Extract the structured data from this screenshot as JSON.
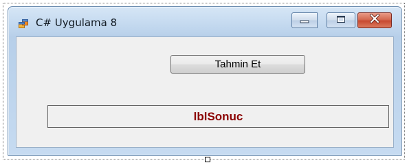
{
  "window": {
    "title": "C# Uygulama 8",
    "controls": {
      "minimize": "minimize-icon",
      "maximize": "maximize-icon",
      "close": "close-icon"
    }
  },
  "form": {
    "button_label": "Tahmin Et",
    "label_text": "lblSonuc",
    "label_color": "#8b0000"
  },
  "colors": {
    "client_background": "#f0f0f0",
    "close_button": "#c74a31",
    "title_bar": "#c1d7ee"
  }
}
